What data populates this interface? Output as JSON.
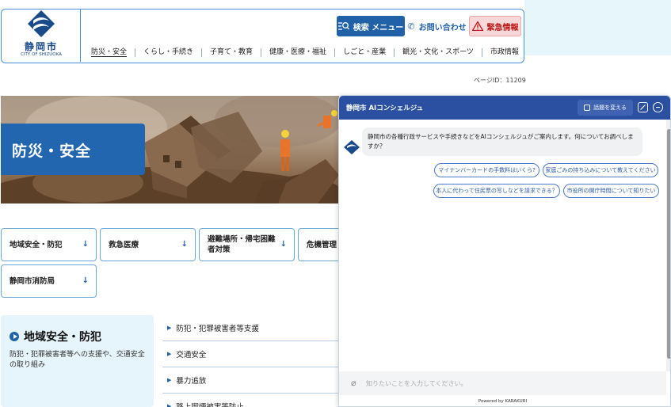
{
  "header": {
    "logo_name": "静岡市",
    "logo_sub": "CITY OF SHIZUOKA",
    "search_menu": "検索 メニュー",
    "contact": "お問い合わせ",
    "emergency": "緊急情報",
    "nav": [
      "防災・安全",
      "くらし・手続き",
      "子育て・教育",
      "健康・医療・福祉",
      "しごと・産業",
      "観光・文化・スポーツ",
      "市政情報"
    ]
  },
  "page_id": "ページID：11209",
  "hero": {
    "title": "防災・安全"
  },
  "categories": [
    "地域安全・防犯",
    "救急医療",
    "避難場所・帰宅困難者対策",
    "危機管理",
    "静岡市消防局"
  ],
  "section": {
    "title": "地域安全・防犯",
    "desc": "防犯・犯罪被害者等への支援や、交通安全の取り組み",
    "links": [
      "防犯・犯罪被害者等支援",
      "交通安全",
      "暴力追放",
      "路上喫煙被害等防止"
    ]
  },
  "chat": {
    "title": "静岡市 AIコンシェルジュ",
    "change_topic": "話題を変える",
    "message": "静岡市の各種行政サービスや手続きなどをAIコンシェルジュがご案内します。何についてお調べしますか？",
    "suggestions": [
      "マイナンバーカードの手数料はいくら?",
      "家庭ごみの持ち込みについて教えてください",
      "本人に代わって住民票の写しなどを請求できる？",
      "市役所の開庁時間について知りたい"
    ],
    "input_placeholder": "知りたいことを入力してください。",
    "powered_by": "Powered by KARAKURI"
  },
  "colors": {
    "brand": "#2161a8",
    "chat_header": "#2b4fa1",
    "emergency_bg": "#f7d7d7"
  }
}
